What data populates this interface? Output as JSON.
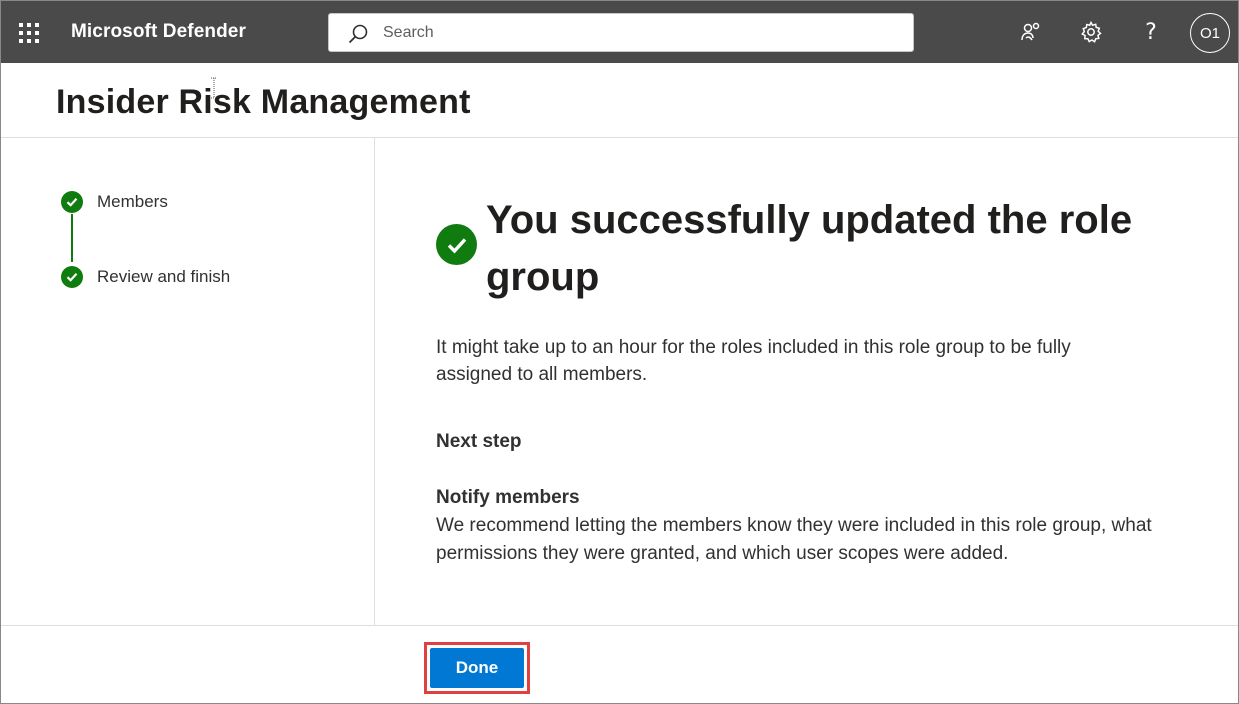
{
  "app": {
    "title": "Microsoft Defender",
    "avatar_initials": "O1",
    "help_glyph": "?"
  },
  "search": {
    "placeholder": "Search"
  },
  "page": {
    "title": "Insider Risk Management"
  },
  "stepper": {
    "steps": [
      {
        "label": "Members",
        "status": "completed"
      },
      {
        "label": "Review and finish",
        "status": "completed"
      }
    ]
  },
  "main": {
    "heading": "You successfully updated the role group",
    "info": "It might take up to an hour for the roles included in this role group to be fully assigned to all members.",
    "next_step_label": "Next step",
    "notify_title": "Notify members",
    "notify_text": "We recommend letting the members know they were included in this role group, what permissions they were granted, and which user scopes were added."
  },
  "footer": {
    "done_label": "Done"
  },
  "colors": {
    "topbar": "#4a4a4a",
    "success": "#107c10",
    "primary": "#0078d4",
    "highlight": "#e0403f"
  },
  "icons": [
    "app-launcher-icon",
    "search-icon",
    "community-icon",
    "settings-gear-icon",
    "help-icon",
    "check-icon",
    "success-check-icon"
  ]
}
